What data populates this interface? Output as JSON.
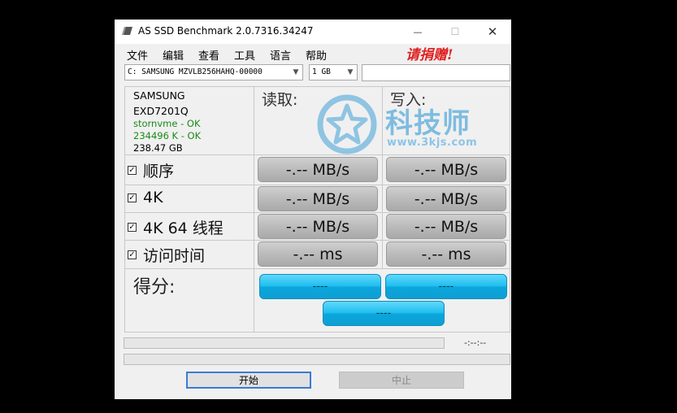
{
  "window": {
    "title": "AS SSD Benchmark 2.0.7316.34247",
    "controls": {
      "minimize": "—",
      "maximize": "☐",
      "close": "✕"
    }
  },
  "menu": [
    "文件",
    "编辑",
    "查看",
    "工具",
    "语言",
    "帮助"
  ],
  "donate_label": "请捐赠!",
  "drive_select": {
    "value": "C: SAMSUNG MZVLB256HAHQ-00000"
  },
  "size_select": {
    "value": "1 GB"
  },
  "drive_info": {
    "vendor": "SAMSUNG",
    "firmware": "EXD7201Q",
    "driver": "stornvme - OK",
    "alignment": "234496 K - OK",
    "capacity": "238.47 GB"
  },
  "columns": {
    "read": "读取:",
    "write": "写入:"
  },
  "rows": [
    {
      "label": "顺序",
      "checked": true,
      "read": "-.-- MB/s",
      "write": "-.-- MB/s"
    },
    {
      "label": "4K",
      "checked": true,
      "read": "-.-- MB/s",
      "write": "-.-- MB/s"
    },
    {
      "label": "4K 64 线程",
      "checked": true,
      "read": "-.-- MB/s",
      "write": "-.-- MB/s"
    },
    {
      "label": "访问时间",
      "checked": true,
      "read": "-.-- ms",
      "write": "-.-- ms"
    }
  ],
  "score": {
    "label": "得分:",
    "read": "----",
    "write": "----",
    "total": "----"
  },
  "elapsed": "-:--:--",
  "buttons": {
    "start": "开始",
    "stop": "中止"
  },
  "watermark": {
    "text": "科技师",
    "url": "www.3kjs.com"
  },
  "colors": {
    "score_accent": "#1ebdef",
    "ok_text": "#1a8a1a",
    "donate": "#e02020",
    "watermark": "#7ebcdf"
  }
}
